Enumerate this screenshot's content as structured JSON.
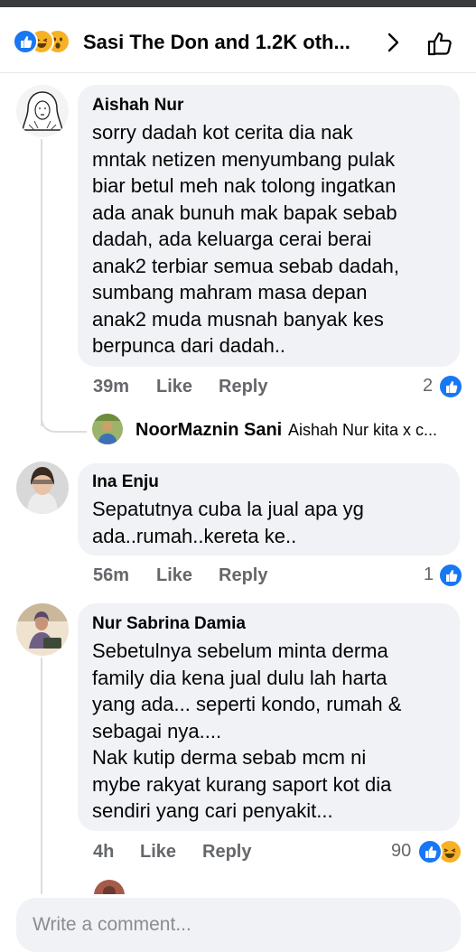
{
  "header": {
    "title": "Sasi The Don and 1.2K oth...",
    "reactions": [
      "like-icon",
      "haha-icon",
      "wow-icon"
    ],
    "icons": [
      "chevron-right-icon",
      "thumbs-up-icon"
    ]
  },
  "comments": [
    {
      "name": "Aishah Nur",
      "text": "sorry dadah kot cerita dia nak\nmntak netizen menyumbang pulak\nbiar betul meh nak tolong ingatkan\nada anak bunuh mak bapak sebab\ndadah, ada keluarga cerai berai\nanak2 terbiar semua sebab dadah,\nsumbang mahram masa depan\nanak2 muda musnah banyak kes\nberpunca dari dadah..",
      "time": "39m",
      "like": "Like",
      "reply": "Reply",
      "reaction_count": "2",
      "reactions": [
        "like-icon"
      ]
    },
    {
      "name": "Ina Enju",
      "text": "Sepatutnya cuba la jual apa yg\nada..rumah..kereta ke..",
      "time": "56m",
      "like": "Like",
      "reply": "Reply",
      "reaction_count": "1",
      "reactions": [
        "like-icon"
      ]
    },
    {
      "name": "Nur Sabrina Damia",
      "text": "Sebetulnya sebelum minta derma\nfamily dia kena jual dulu lah harta\nyang ada... seperti kondo, rumah &\nsebagai nya....\nNak kutip derma sebab mcm ni\nmybe rakyat kurang saport kot dia\nsendiri yang cari penyakit...",
      "time": "4h",
      "like": "Like",
      "reply": "Reply",
      "reaction_count": "90",
      "reactions": [
        "like-icon",
        "haha-icon"
      ]
    }
  ],
  "reply_preview": {
    "name": "NoorMaznin Sani",
    "text": "Aishah Nur kita x c..."
  },
  "composer": {
    "placeholder": "Write a comment..."
  },
  "colors": {
    "like": "#1877f2",
    "haha": "#f7b125",
    "bubble": "#f0f2f5",
    "muted_text": "#65676b"
  }
}
